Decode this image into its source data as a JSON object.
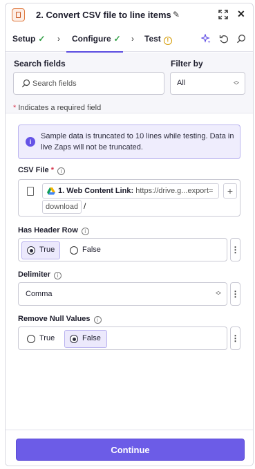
{
  "header": {
    "title": "2. Convert CSV file to line items"
  },
  "tabs": [
    {
      "label": "Setup",
      "status": "complete"
    },
    {
      "label": "Configure",
      "status": "complete"
    },
    {
      "label": "Test",
      "status": "warning"
    }
  ],
  "search": {
    "label": "Search fields",
    "placeholder": "Search fields",
    "filter_label": "Filter by",
    "filter_value": "All",
    "required_note": "Indicates a required field",
    "required_marker": "*"
  },
  "info": {
    "text": "Sample data is truncated to 10 lines while testing. Data in live Zaps will not be truncated."
  },
  "fields": {
    "csv_file": {
      "label": "CSV File",
      "required_marker": "*",
      "pill_step": "1. Web Content Link:",
      "pill_value": "https://drive.g...export=",
      "pill_value_2": "download",
      "suffix": "/"
    },
    "has_header_row": {
      "label": "Has Header Row",
      "options": [
        "True",
        "False"
      ],
      "selected": "True"
    },
    "delimiter": {
      "label": "Delimiter",
      "value": "Comma"
    },
    "remove_null_values": {
      "label": "Remove Null Values",
      "options": [
        "True",
        "False"
      ],
      "selected": "False"
    }
  },
  "footer": {
    "continue_label": "Continue"
  },
  "colors": {
    "accent": "#6c5ce7",
    "success": "#2f9e44",
    "warning": "#d49a00",
    "required": "#d6334a"
  }
}
